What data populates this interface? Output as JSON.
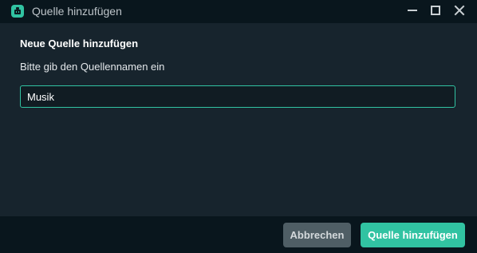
{
  "window": {
    "title": "Quelle hinzufügen",
    "icon": "streamlabs-app-icon",
    "controls": [
      "minimize-icon",
      "maximize-icon",
      "close-icon"
    ]
  },
  "form": {
    "heading": "Neue Quelle hinzufügen",
    "prompt": "Bitte gib den Quellennamen ein",
    "name_value": "Musik",
    "name_placeholder": ""
  },
  "footer": {
    "cancel_label": "Abbrechen",
    "add_label": "Quelle hinzufügen"
  },
  "colors": {
    "accent": "#31c3a2",
    "background": "#17242d",
    "titlebar": "#09161d",
    "cancel_button": "#4f5e65"
  }
}
